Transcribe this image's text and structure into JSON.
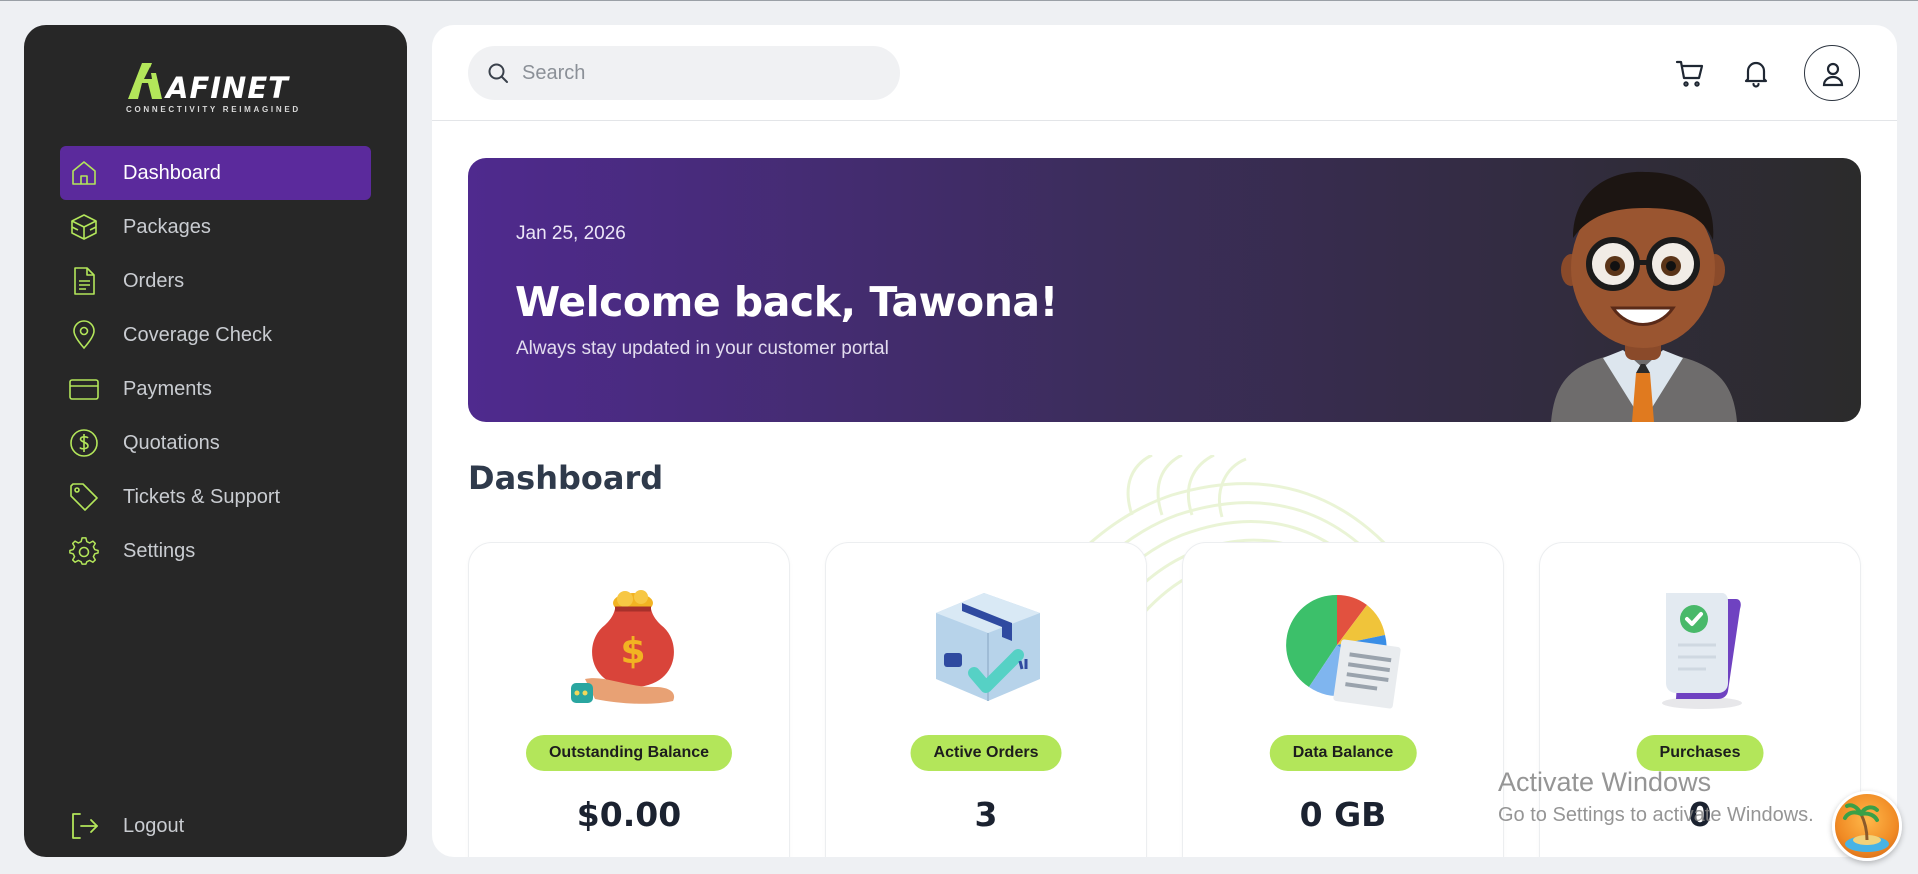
{
  "brand": {
    "name": "AFINET",
    "tagline": "CONNECTIVITY REIMAGINED",
    "accent": "#b3e65a",
    "purple": "#5b2a9c"
  },
  "sidebar": {
    "items": [
      {
        "label": "Dashboard",
        "icon": "home-icon",
        "active": true
      },
      {
        "label": "Packages",
        "icon": "box-icon",
        "active": false
      },
      {
        "label": "Orders",
        "icon": "document-icon",
        "active": false
      },
      {
        "label": "Coverage Check",
        "icon": "map-pin-icon",
        "active": false
      },
      {
        "label": "Payments",
        "icon": "credit-card-icon",
        "active": false
      },
      {
        "label": "Quotations",
        "icon": "dollar-circle-icon",
        "active": false
      },
      {
        "label": "Tickets & Support",
        "icon": "tag-icon",
        "active": false
      },
      {
        "label": "Settings",
        "icon": "gear-icon",
        "active": false
      }
    ],
    "logout_label": "Logout"
  },
  "header": {
    "search_placeholder": "Search"
  },
  "banner": {
    "date": "Jan 25, 2026",
    "title": "Welcome back, Tawona!",
    "subtitle": "Always stay updated in your customer portal"
  },
  "dashboard": {
    "title": "Dashboard",
    "cards": [
      {
        "label": "Outstanding Balance",
        "value": "$0.00",
        "icon": "money-bag-icon"
      },
      {
        "label": "Active Orders",
        "value": "3",
        "icon": "package-icon"
      },
      {
        "label": "Data Balance",
        "value": "0 GB",
        "icon": "pie-chart-icon"
      },
      {
        "label": "Purchases",
        "value": "0",
        "icon": "receipt-check-icon"
      }
    ]
  },
  "os_overlay": {
    "line1": "Activate Windows",
    "line2": "Go to Settings to activate Windows."
  }
}
